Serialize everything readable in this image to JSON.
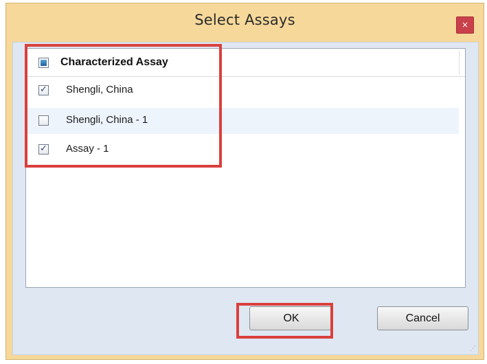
{
  "window": {
    "title": "Select Assays",
    "close_symbol": "×"
  },
  "list": {
    "header": "Characterized Assay",
    "header_checkbox_state": "indeterminate",
    "items": [
      {
        "label": "Shengli, China",
        "checked": true
      },
      {
        "label": "Shengli, China - 1",
        "checked": false
      },
      {
        "label": "Assay - 1",
        "checked": true
      }
    ]
  },
  "buttons": {
    "ok_label": "OK",
    "cancel_label": "Cancel"
  },
  "colors": {
    "window_frame": "#f6d89a",
    "close_button": "#c9404b",
    "highlight": "#d9403d",
    "content_bg": "#dfe7f2"
  },
  "icons": {
    "close": "close-icon",
    "checkbox_checked": "check-icon",
    "resize_grip": "resize-grip-icon"
  }
}
